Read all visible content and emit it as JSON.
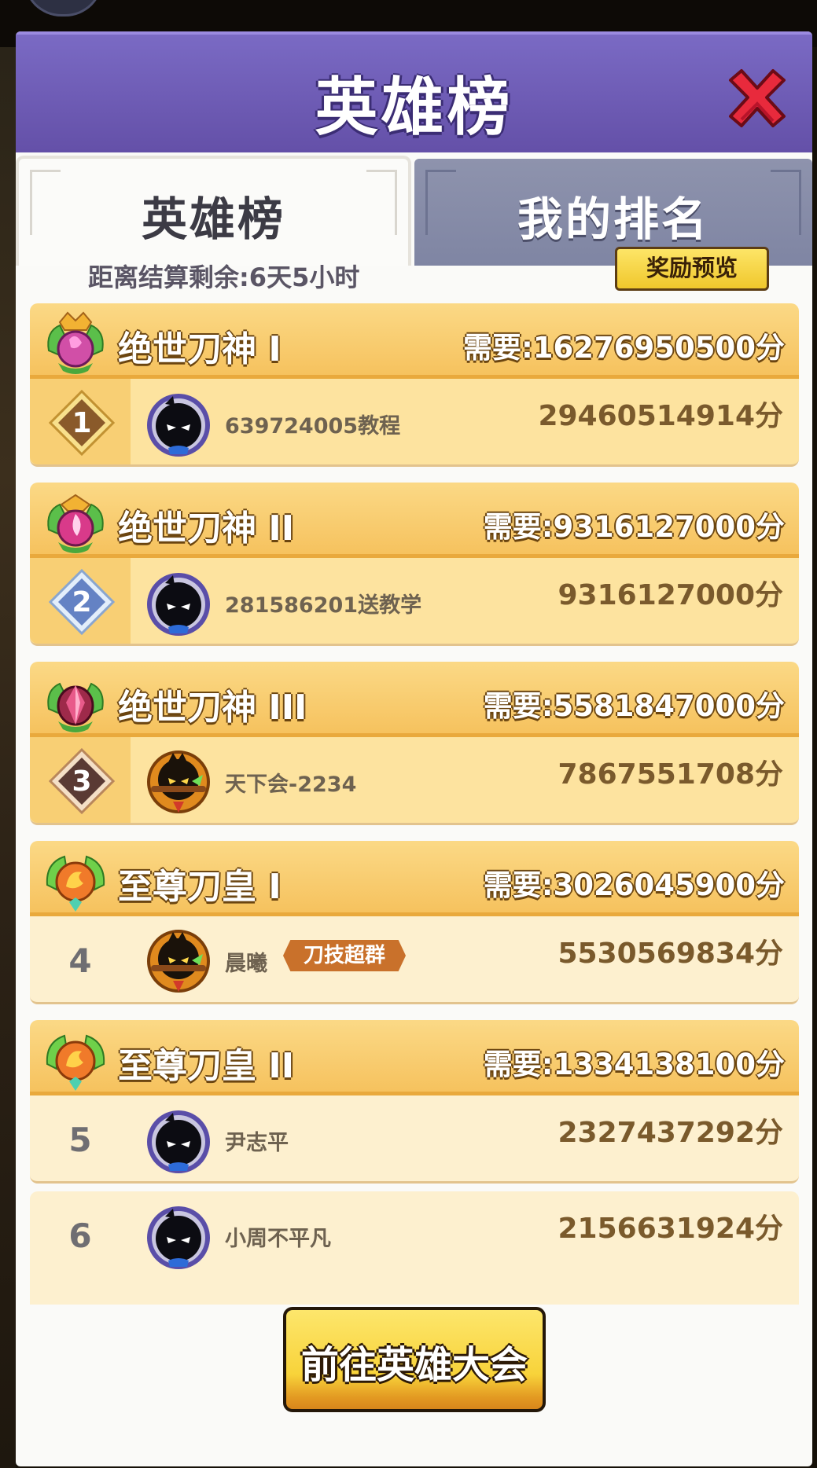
{
  "header": {
    "title": "英雄榜",
    "close_icon": "close-x-icon"
  },
  "tabs": [
    {
      "label": "英雄榜",
      "active": true
    },
    {
      "label": "我的排名",
      "active": false
    }
  ],
  "countdown_text": "距离结算剩余:6天5小时",
  "reward_preview_label": "奖励预览",
  "tiers": [
    {
      "name": "绝世刀神 I",
      "requirement": "需要:16276950500分",
      "emblem": "purple-flame-emblem-icon",
      "player": {
        "rank": "1",
        "name": "639724005教程",
        "score": "29460514914分",
        "avatar": "shadow-ninja-avatar-icon"
      }
    },
    {
      "name": "绝世刀神 II",
      "requirement": "需要:9316127000分",
      "emblem": "pink-flame-emblem-icon",
      "player": {
        "rank": "2",
        "name": "281586201送教学",
        "score": "9316127000分",
        "avatar": "shadow-ninja-avatar-icon"
      }
    },
    {
      "name": "绝世刀神 III",
      "requirement": "需要:5581847000分",
      "emblem": "crimson-crystal-emblem-icon",
      "player": {
        "rank": "3",
        "name": "天下会-2234",
        "score": "7867551708分",
        "avatar": "gold-warrior-avatar-icon"
      }
    },
    {
      "name": "至尊刀皇 I",
      "requirement": "需要:3026045900分",
      "emblem": "phoenix-emblem-icon",
      "player": {
        "rank": "4",
        "name": "晨曦",
        "score": "5530569834分",
        "avatar": "gold-warrior-avatar-icon",
        "title_badge": "刀技超群"
      }
    },
    {
      "name": "至尊刀皇 II",
      "requirement": "需要:1334138100分",
      "emblem": "phoenix-emblem-icon",
      "player": {
        "rank": "5",
        "name": "尹志平",
        "score": "2327437292分",
        "avatar": "shadow-ninja-avatar-icon"
      }
    }
  ],
  "extra_player": {
    "rank": "6",
    "name": "小周不平凡",
    "score": "2156631924分",
    "avatar": "shadow-ninja-avatar-icon"
  },
  "go_button_label": "前往英雄大会",
  "colors": {
    "header_purple": "#6f5db8",
    "tier_gold": "#f6c25e",
    "button_yellow": "#f8d33a"
  }
}
